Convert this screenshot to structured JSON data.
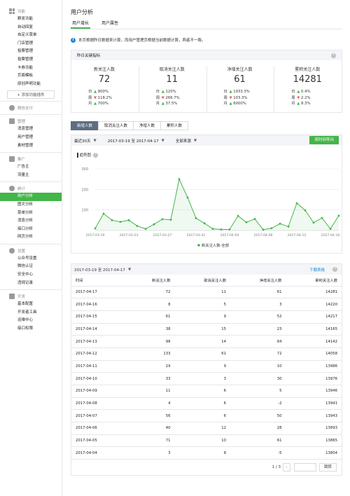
{
  "sidebar": {
    "sections": [
      {
        "title": "功能",
        "items": [
          {
            "label": "群发功能"
          },
          {
            "label": "自动回复"
          },
          {
            "label": "自定义菜单"
          },
          {
            "label": "门店管理"
          },
          {
            "label": "投票管理"
          },
          {
            "label": "投票管理"
          },
          {
            "label": "卡券功能"
          },
          {
            "label": "页面模板"
          },
          {
            "label": "原创声明功能"
          }
        ]
      },
      {
        "title": "微信支付",
        "items": []
      },
      {
        "title": "管理",
        "items": [
          {
            "label": "消息管理"
          },
          {
            "label": "用户管理"
          },
          {
            "label": "素材管理"
          }
        ]
      },
      {
        "title": "推广",
        "items": [
          {
            "label": "广告主"
          },
          {
            "label": "流量主"
          }
        ]
      },
      {
        "title": "统计",
        "items": [
          {
            "label": "用户分析"
          },
          {
            "label": "图文分析"
          },
          {
            "label": "菜单分析"
          },
          {
            "label": "消息分析"
          },
          {
            "label": "接口分析"
          },
          {
            "label": "网页分析"
          }
        ]
      },
      {
        "title": "设置",
        "items": [
          {
            "label": "公众号设置"
          },
          {
            "label": "微信认证"
          },
          {
            "label": "安全中心"
          },
          {
            "label": "违规记录"
          }
        ]
      },
      {
        "title": "开发",
        "items": [
          {
            "label": "基本配置"
          },
          {
            "label": "开发者工具"
          },
          {
            "label": "运维中心"
          },
          {
            "label": "接口权限"
          }
        ]
      }
    ],
    "add_plugin_label": "+ 添加功能插件"
  },
  "page_title": "用户分析",
  "tabs": [
    {
      "label": "用户增长"
    },
    {
      "label": "用户属性"
    }
  ],
  "notice": "本页根据昨日数据来计算，而用户管理页根据当前数据计算，两者不一致。",
  "kpi_box": {
    "title": "昨日关键指标",
    "kpis": [
      {
        "label": "新关注人数",
        "value": "72",
        "rows": [
          {
            "k": "日",
            "arrow": "up",
            "v": "800%"
          },
          {
            "k": "周",
            "arrow": "down",
            "v": "118.2%"
          },
          {
            "k": "月",
            "arrow": "up",
            "v": "700%"
          }
        ]
      },
      {
        "label": "取消关注人数",
        "value": "11",
        "rows": [
          {
            "k": "日",
            "arrow": "up",
            "v": "120%"
          },
          {
            "k": "周",
            "arrow": "down",
            "v": "266.7%"
          },
          {
            "k": "月",
            "arrow": "up",
            "v": "37.5%"
          }
        ]
      },
      {
        "label": "净增关注人数",
        "value": "61",
        "rows": [
          {
            "k": "日",
            "arrow": "up",
            "v": "1933.3%"
          },
          {
            "k": "周",
            "arrow": "down",
            "v": "103.3%"
          },
          {
            "k": "月",
            "arrow": "up",
            "v": "6000%"
          }
        ]
      },
      {
        "label": "累积关注人数",
        "value": "14281",
        "rows": [
          {
            "k": "日",
            "arrow": "up",
            "v": "0.4%"
          },
          {
            "k": "周",
            "arrow": "down",
            "v": "2.2%"
          },
          {
            "k": "月",
            "arrow": "up",
            "v": "8.3%"
          }
        ]
      }
    ]
  },
  "metric_tabs": [
    {
      "label": "新增人数"
    },
    {
      "label": "取消关注人数"
    },
    {
      "label": "净增人数"
    },
    {
      "label": "累积人数"
    }
  ],
  "filter": {
    "period": "最近30天",
    "range": "2017-03-19 至 2017-04-17",
    "source": "全部来源",
    "export_label": "按时间导出"
  },
  "chart_title": "趋势图",
  "chart_data": {
    "type": "line",
    "x": [
      "2017-03-19",
      "2017-03-20",
      "2017-03-21",
      "2017-03-22",
      "2017-03-23",
      "2017-03-24",
      "2017-03-25",
      "2017-03-26",
      "2017-03-27",
      "2017-03-28",
      "2017-03-29",
      "2017-03-30",
      "2017-03-31",
      "2017-04-01",
      "2017-04-02",
      "2017-04-03",
      "2017-04-04",
      "2017-04-05",
      "2017-04-06",
      "2017-04-07",
      "2017-04-08",
      "2017-04-09",
      "2017-04-10",
      "2017-04-11",
      "2017-04-12",
      "2017-04-13",
      "2017-04-14",
      "2017-04-15",
      "2017-04-16",
      "2017-04-17"
    ],
    "tick_labels": [
      "2017-03-19",
      "2017-03-23",
      "2017-03-27",
      "2017-03-31",
      "2017-04-04",
      "2017-04-08",
      "2017-04-12",
      "2017-04-16"
    ],
    "series": [
      {
        "name": "新关注人数-全部",
        "values": [
          10,
          82,
          50,
          42,
          50,
          22,
          8,
          30,
          55,
          52,
          250,
          160,
          60,
          35,
          8,
          5,
          5,
          71,
          40,
          56,
          4,
          11,
          33,
          19,
          133,
          98,
          38,
          61,
          8,
          72
        ]
      }
    ],
    "ylim": [
      0,
      300
    ],
    "yticks": [
      100,
      200,
      300
    ],
    "color": "#44b549",
    "legend": "bottom"
  },
  "table": {
    "range_label": "2017-03-19 至 2017-04-17",
    "download_label": "下载表格",
    "columns": [
      "时间",
      "新关注人数",
      "取消关注人数",
      "净增关注人数",
      "累积关注人数"
    ],
    "rows": [
      [
        "2017-04-17",
        "72",
        "11",
        "61",
        "14281"
      ],
      [
        "2017-04-16",
        "8",
        "5",
        "3",
        "14220"
      ],
      [
        "2017-04-15",
        "61",
        "9",
        "52",
        "14217"
      ],
      [
        "2017-04-14",
        "38",
        "15",
        "23",
        "14165"
      ],
      [
        "2017-04-13",
        "98",
        "14",
        "84",
        "14142"
      ],
      [
        "2017-04-12",
        "133",
        "61",
        "72",
        "14058"
      ],
      [
        "2017-04-11",
        "19",
        "9",
        "10",
        "13986"
      ],
      [
        "2017-04-10",
        "33",
        "3",
        "30",
        "13976"
      ],
      [
        "2017-04-09",
        "11",
        "6",
        "5",
        "13946"
      ],
      [
        "2017-04-08",
        "4",
        "6",
        "-2",
        "13941"
      ],
      [
        "2017-04-07",
        "56",
        "6",
        "50",
        "13943"
      ],
      [
        "2017-04-06",
        "40",
        "12",
        "28",
        "13893"
      ],
      [
        "2017-04-05",
        "71",
        "10",
        "61",
        "13865"
      ],
      [
        "2017-04-04",
        "3",
        "8",
        "-5",
        "13804"
      ]
    ],
    "pager": {
      "page": "1 / 3",
      "go_label": "跳转"
    }
  }
}
